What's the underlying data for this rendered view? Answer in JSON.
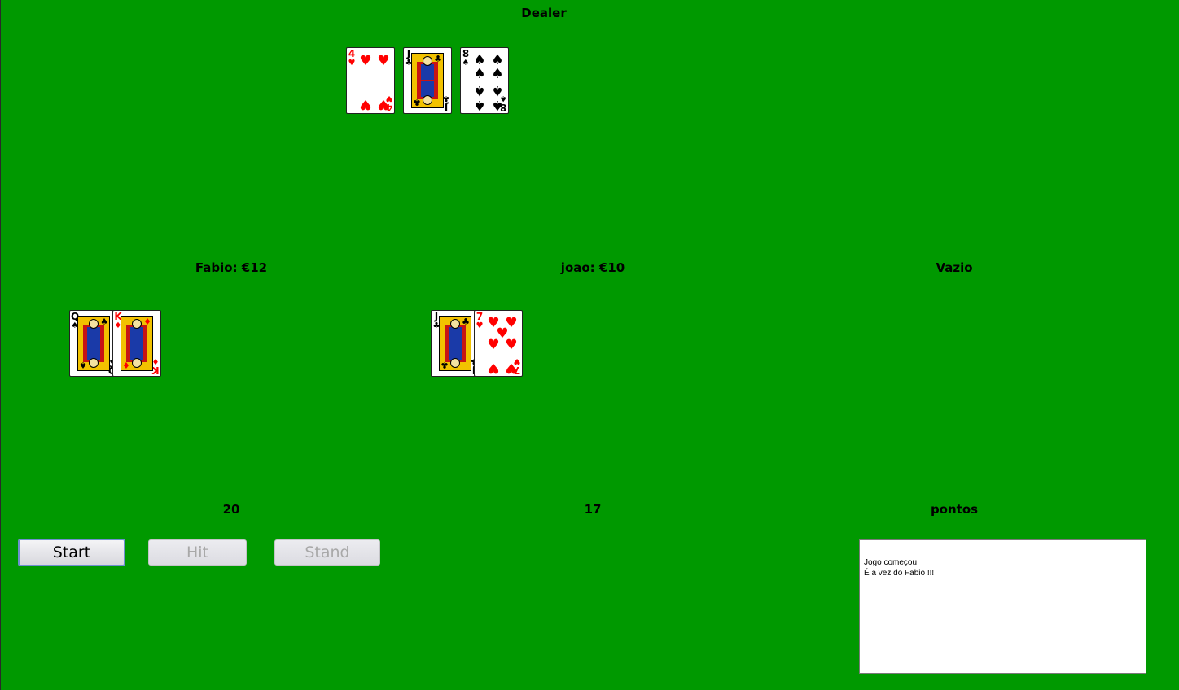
{
  "dealer": {
    "title": "Dealer",
    "cards": [
      {
        "rank": "4",
        "suit": "♥",
        "color": "red"
      },
      {
        "rank": "J",
        "suit": "♣",
        "color": "black"
      },
      {
        "rank": "8",
        "suit": "♠",
        "color": "black"
      }
    ]
  },
  "players": [
    {
      "name_label": "Fabio: €12",
      "score": "20",
      "cards": [
        {
          "rank": "Q",
          "suit": "♠",
          "color": "black"
        },
        {
          "rank": "K",
          "suit": "♦",
          "color": "red"
        }
      ]
    },
    {
      "name_label": "joao: €10",
      "score": "17",
      "cards": [
        {
          "rank": "J",
          "suit": "♣",
          "color": "black"
        },
        {
          "rank": "7",
          "suit": "♥",
          "color": "red"
        }
      ]
    },
    {
      "name_label": "Vazio",
      "score": "pontos",
      "cards": []
    }
  ],
  "controls": {
    "start_label": "Start",
    "hit_label": "Hit",
    "stand_label": "Stand"
  },
  "log": {
    "lines": [
      "Jogo começou",
      "É a vez do Fabio !!!"
    ]
  },
  "colors": {
    "table_felt": "#009900",
    "red_suit": "#ff0000",
    "black_suit": "#000000"
  }
}
